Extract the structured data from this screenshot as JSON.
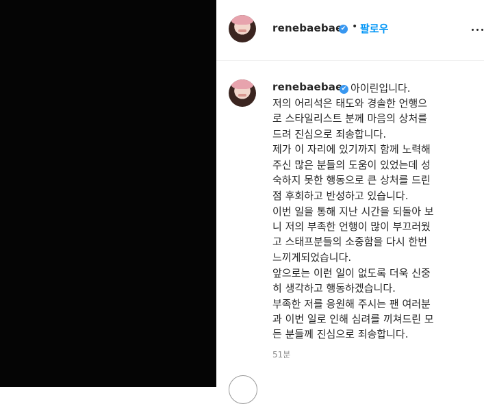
{
  "header": {
    "username": "renebaebae",
    "verified_glyph": "✔",
    "separator": "•",
    "follow_label": "팔로우"
  },
  "caption": {
    "username": "renebaebae",
    "lines": [
      "아이린입니다.",
      "저의 어리석은 태도와 경솔한 언행으",
      "로 스타일리스트 분께 마음의 상처를",
      "드려 진심으로 죄송합니다.",
      "제가 이 자리에 있기까지 함께 노력해",
      "주신 많은 분들의 도움이 있었는데 성",
      "숙하지 못한 행동으로 큰 상처를 드린",
      "점 후회하고 반성하고 있습니다.",
      "이번 일을 통해 지난 시간을 되돌아 보",
      "니 저의 부족한 언행이 많이 부끄러웠",
      "고 스태프분들의 소중함을 다시 한번",
      "느끼게되었습니다.",
      "앞으로는 이런 일이 없도록 더욱 신중",
      "히 생각하고 행동하겠습니다.",
      "부족한 저를 응원해 주시는 팬 여러분",
      "과 이번 일로 인해 심려를 끼쳐드린 모",
      "든 분들께 진심으로 죄송합니다."
    ],
    "timestamp": "51분"
  },
  "icons": {
    "verified": "verified-badge-icon",
    "more": "more-options-icon",
    "avatar": "profile-avatar"
  },
  "colors": {
    "follow": "#0095f6",
    "verified": "#3897f0",
    "media_bg": "#050505",
    "timestamp": "#8e8e8e"
  }
}
